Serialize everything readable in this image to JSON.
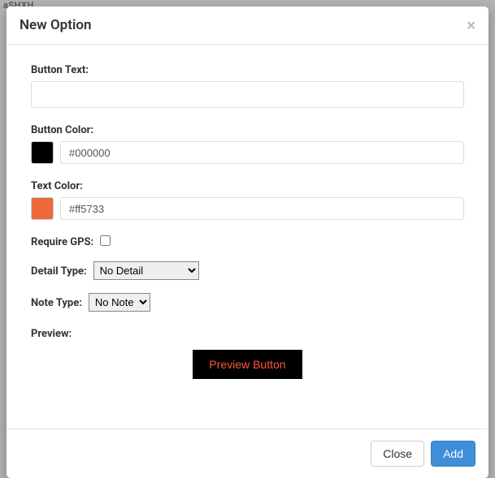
{
  "modal": {
    "title": "New Option",
    "close_x": "×"
  },
  "form": {
    "button_text": {
      "label": "Button Text:",
      "value": ""
    },
    "button_color": {
      "label": "Button Color:",
      "value": "#000000",
      "swatch": "#000000"
    },
    "text_color": {
      "label": "Text Color:",
      "value": "#ff5733",
      "swatch": "#ed693c"
    },
    "require_gps": {
      "label": "Require GPS:",
      "checked": false
    },
    "detail_type": {
      "label": "Detail Type:",
      "selected": "No Detail"
    },
    "note_type": {
      "label": "Note Type:",
      "selected": "No Note"
    },
    "preview": {
      "label": "Preview:",
      "button_label": "Preview Button"
    }
  },
  "footer": {
    "close": "Close",
    "add": "Add"
  },
  "bg": {
    "ashxd": "aSHXH"
  }
}
